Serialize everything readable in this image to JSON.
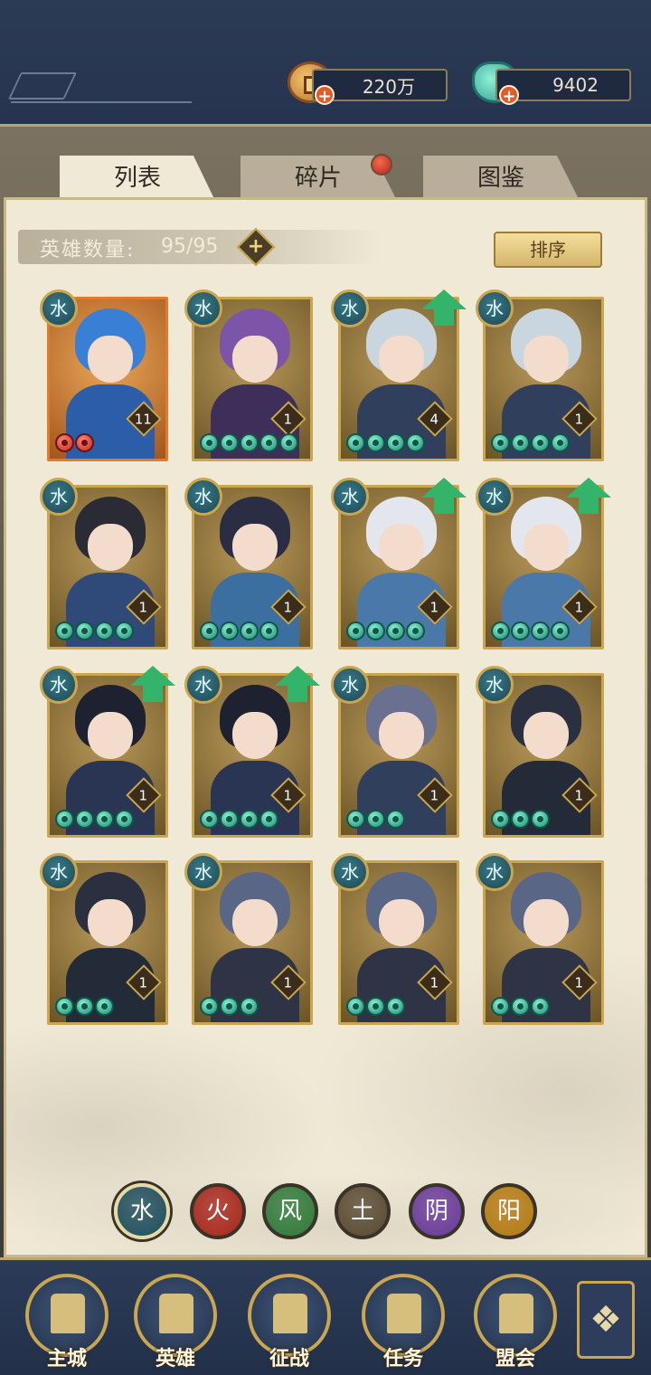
{
  "header": {
    "coins": "220万",
    "jade": "9402"
  },
  "tabs": [
    {
      "label": "列表",
      "active": true
    },
    {
      "label": "碎片",
      "active": false,
      "badge": true
    },
    {
      "label": "图鉴",
      "active": false
    }
  ],
  "roster": {
    "count_label": "英雄数量:",
    "count_value": "95/95",
    "sort_label": "排序"
  },
  "heroes": [
    {
      "level": "11",
      "stars": 2,
      "star_color": "red",
      "border": "orange",
      "upgrade": false,
      "palette": "blue-hair"
    },
    {
      "level": "1",
      "stars": 5,
      "star_color": "green",
      "border": "gold",
      "upgrade": false,
      "palette": "purple-hair"
    },
    {
      "level": "4",
      "stars": 4,
      "star_color": "green",
      "border": "gold",
      "upgrade": true,
      "palette": "silver-armor"
    },
    {
      "level": "1",
      "stars": 4,
      "star_color": "green",
      "border": "gold",
      "upgrade": false,
      "palette": "silver-armor"
    },
    {
      "level": "1",
      "stars": 4,
      "star_color": "green",
      "border": "gold",
      "upgrade": false,
      "palette": "dark-swordsman"
    },
    {
      "level": "1",
      "stars": 4,
      "star_color": "green",
      "border": "gold",
      "upgrade": false,
      "palette": "flower-maiden"
    },
    {
      "level": "1",
      "stars": 4,
      "star_color": "green",
      "border": "gold",
      "upgrade": true,
      "palette": "white-hair"
    },
    {
      "level": "1",
      "stars": 4,
      "star_color": "green",
      "border": "gold",
      "upgrade": true,
      "palette": "white-hair"
    },
    {
      "level": "1",
      "stars": 4,
      "star_color": "green",
      "border": "gold",
      "upgrade": true,
      "palette": "black-official"
    },
    {
      "level": "1",
      "stars": 4,
      "star_color": "green",
      "border": "gold",
      "upgrade": true,
      "palette": "black-official"
    },
    {
      "level": "1",
      "stars": 3,
      "star_color": "green",
      "border": "gold",
      "upgrade": false,
      "palette": "grey-warrior"
    },
    {
      "level": "1",
      "stars": 3,
      "star_color": "green",
      "border": "gold",
      "upgrade": false,
      "palette": "hooded-ninja"
    },
    {
      "level": "1",
      "stars": 3,
      "star_color": "green",
      "border": "gold",
      "upgrade": false,
      "palette": "hooded-ninja"
    },
    {
      "level": "1",
      "stars": 3,
      "star_color": "green",
      "border": "gold",
      "upgrade": false,
      "palette": "grey-brute"
    },
    {
      "level": "1",
      "stars": 3,
      "star_color": "green",
      "border": "gold",
      "upgrade": false,
      "palette": "grey-brute"
    },
    {
      "level": "1",
      "stars": 3,
      "star_color": "green",
      "border": "gold",
      "upgrade": false,
      "palette": "grey-brute"
    }
  ],
  "element_badge_glyph": "水",
  "element_filters": [
    {
      "glyph": "水",
      "color": "#1f4e5e",
      "active": true
    },
    {
      "glyph": "火",
      "color": "#a8281d",
      "active": false
    },
    {
      "glyph": "风",
      "color": "#2f7a3a",
      "active": false
    },
    {
      "glyph": "土",
      "color": "#5a4a33",
      "active": false
    },
    {
      "glyph": "阴",
      "color": "#6a3a9a",
      "active": false
    },
    {
      "glyph": "阳",
      "color": "#b47a12",
      "active": false
    }
  ],
  "nav": [
    {
      "label": "主城",
      "icon": "city-gate-icon"
    },
    {
      "label": "英雄",
      "icon": "hero-portrait-icon"
    },
    {
      "label": "征战",
      "icon": "battle-scroll-icon"
    },
    {
      "label": "任务",
      "icon": "quest-scroll-icon"
    },
    {
      "label": "盟会",
      "icon": "alliance-pavilion-icon"
    }
  ],
  "nav_more_icon": "four-petal-menu-icon",
  "colors": {
    "gold_border": "#c9a64f",
    "jade_star": "#17856e",
    "panel": "#efe9d6",
    "navy": "#24324a"
  }
}
